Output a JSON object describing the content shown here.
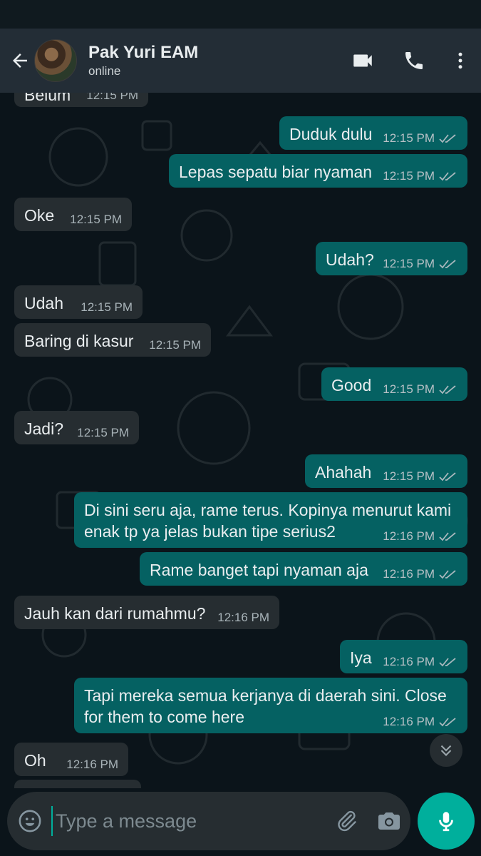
{
  "header": {
    "contact_name": "Pak Yuri EAM",
    "contact_status": "online"
  },
  "messages": [
    {
      "dir": "in",
      "text": "Belum",
      "time": "12:15 PM"
    },
    {
      "dir": "out",
      "text": "Duduk dulu",
      "time": "12:15 PM",
      "status": "read"
    },
    {
      "dir": "out",
      "text": "Lepas sepatu biar nyaman",
      "time": "12:15 PM",
      "status": "read"
    },
    {
      "dir": "in",
      "text": "Oke",
      "time": "12:15 PM"
    },
    {
      "dir": "out",
      "text": "Udah?",
      "time": "12:15 PM",
      "status": "read"
    },
    {
      "dir": "in",
      "text": "Udah",
      "time": "12:15 PM"
    },
    {
      "dir": "in",
      "text": "Baring di kasur",
      "time": "12:15 PM"
    },
    {
      "dir": "out",
      "text": "Good",
      "time": "12:15 PM",
      "status": "read"
    },
    {
      "dir": "in",
      "text": "Jadi?",
      "time": "12:15 PM"
    },
    {
      "dir": "out",
      "text": "Ahahah",
      "time": "12:15 PM",
      "status": "read"
    },
    {
      "dir": "out",
      "line1": "Di sini seru aja, rame terus. Kopinya menurut kami",
      "line2": "enak tp ya jelas bukan tipe serius2",
      "time": "12:16 PM",
      "status": "read"
    },
    {
      "dir": "out",
      "text": "Rame banget tapi nyaman aja",
      "time": "12:16 PM",
      "status": "read"
    },
    {
      "dir": "in",
      "text": "Jauh kan dari rumahmu?",
      "time": "12:16 PM"
    },
    {
      "dir": "out",
      "text": "Iya",
      "time": "12:16 PM",
      "status": "read"
    },
    {
      "dir": "out",
      "line1": "Tapi mereka semua kerjanya di daerah sini. Close",
      "line2": "for them to come here",
      "time": "12:16 PM",
      "status": "read"
    },
    {
      "dir": "in",
      "text": "Oh",
      "time": "12:16 PM"
    }
  ],
  "composer": {
    "placeholder": "Type a message"
  },
  "icons": {
    "back": "arrow-left-icon",
    "video": "video-call-icon",
    "call": "phone-icon",
    "menu": "more-vert-icon",
    "emoji": "emoji-icon",
    "attach": "paperclip-icon",
    "camera": "camera-icon",
    "mic": "mic-icon",
    "scroll": "chevron-double-down-icon"
  },
  "colors": {
    "header_bg": "#232d36",
    "incoming_bubble": "#262d31",
    "outgoing_bubble": "#056162",
    "accent": "#00af9c"
  }
}
